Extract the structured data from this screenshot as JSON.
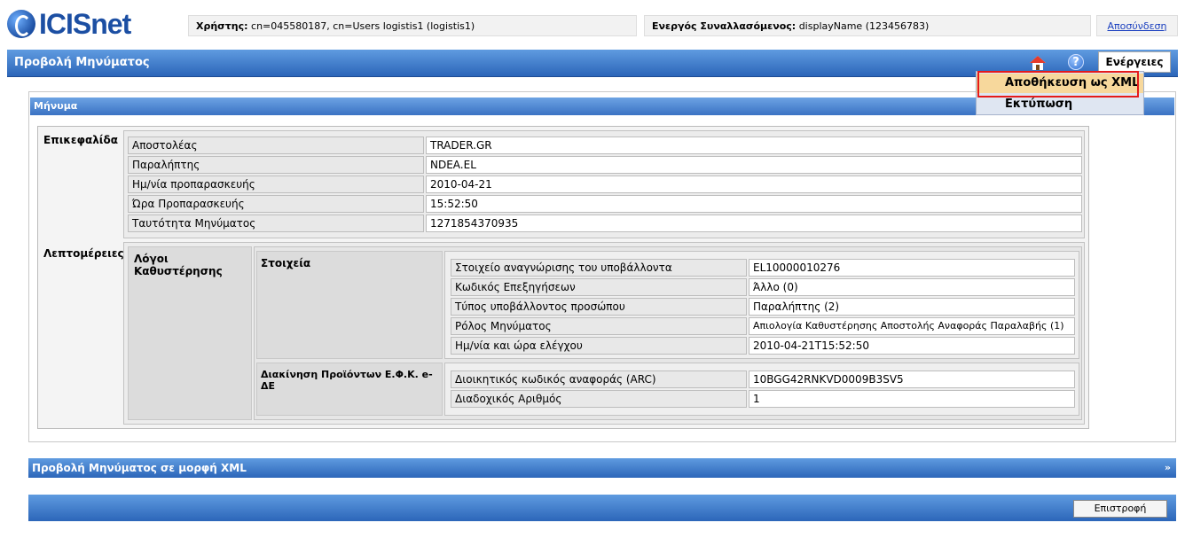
{
  "app": {
    "logo_text": "ICISnet"
  },
  "header": {
    "user_label": "Χρήστης:",
    "user_value": "cn=045580187, cn=Users logistis1 (logistis1)",
    "trader_label": "Ενεργός Συναλλασόμενος:",
    "trader_value": "displayName (123456783)",
    "logout": "Αποσύνδεση"
  },
  "page": {
    "title": "Προβολή Μηνύματος",
    "help_glyph": "?",
    "actions_label": "Ενέργειες"
  },
  "actions_menu": {
    "items": [
      {
        "label": "Αποθήκευση ως XML"
      },
      {
        "label": "Εκτύπωση"
      }
    ],
    "highlight_color": "#e51b1b"
  },
  "message_panel": {
    "title": "Μήνυμα",
    "header_section": {
      "label": "Επικεφαλίδα",
      "rows": [
        {
          "key": "Αποστολέας",
          "value": "TRADER.GR"
        },
        {
          "key": "Παραλήπτης",
          "value": "NDEA.EL"
        },
        {
          "key": "Ημ/νία προπαρασκευής",
          "value": "2010-04-21"
        },
        {
          "key": "Ώρα Προπαρασκευής",
          "value": "15:52:50"
        },
        {
          "key": "Ταυτότητα Μηνύματος",
          "value": "1271854370935"
        }
      ]
    },
    "details_section": {
      "label": "Λεπτομέρειες",
      "sub_label": "Λόγοι Καθυστέρησης",
      "elements": {
        "label": "Στοιχεία",
        "rows": [
          {
            "key": "Στοιχείο αναγνώρισης του υποβάλλοντα",
            "value": "EL10000010276"
          },
          {
            "key": "Κωδικός Επεξηγήσεων",
            "value": "Άλλο (0)"
          },
          {
            "key": "Τύπος υποβάλλοντος προσώπου",
            "value": "Παραλήπτης (2)"
          },
          {
            "key": "Ρόλος Μηνύματος",
            "value": "Απιολογία Καθυστέρησης Αποστολής Αναφοράς Παραλαβής (1)"
          },
          {
            "key": "Ημ/νία και ώρα ελέγχου",
            "value": "2010-04-21T15:52:50"
          }
        ]
      },
      "movement": {
        "label": "Διακίνηση Προϊόντων Ε.Φ.Κ. e-ΔΕ",
        "rows": [
          {
            "key": "Διοικητικός κωδικός αναφοράς (ARC)",
            "value": "10BGG42RNKVD0009B3SV5"
          },
          {
            "key": "Διαδοχικός Αριθμός",
            "value": "1"
          }
        ]
      }
    }
  },
  "xml_panel": {
    "title": "Προβολή Μηνύματος σε μορφή XML",
    "chevron": "»"
  },
  "footer": {
    "back_label": "Επιστροφή"
  }
}
